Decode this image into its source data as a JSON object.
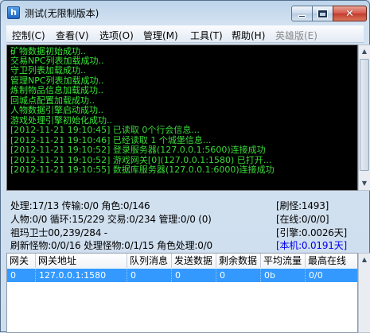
{
  "window": {
    "title": "测试(无限制版本)",
    "app_icon_letter": "h",
    "close_glyph": "✕"
  },
  "menu": [
    {
      "label": "控制(C)",
      "enabled": true
    },
    {
      "label": "查看(V)",
      "enabled": true
    },
    {
      "label": "选项(O)",
      "enabled": true
    },
    {
      "label": "管理(M)",
      "enabled": true
    },
    {
      "label": "工具(T)",
      "enabled": true
    },
    {
      "label": "帮助(H)",
      "enabled": true
    },
    {
      "label": "英雄版(E)",
      "enabled": false
    }
  ],
  "log": [
    "矿物数据初始成功..",
    "交易NPC列表加载成功..",
    "守卫列表加载成功..",
    "管理NPC列表加载成功..",
    "炼制物品信息加载成功..",
    "回城点配置加载成功..",
    "人物数据引擎启动成功..",
    "游戏处理引擎初始化成功..",
    "[2012-11-21 19:10:45] 已读取 0个行会信息...",
    "[2012-11-21 19:10:46] 已经读取 1 个城堡信息...",
    "[2012-11-21 19:10:52] 登录服务器(127.0.0.1:5600)连接成功",
    "[2012-11-21 19:10:52] 游戏网关[0](127.0.0.1:1580) 已打开...",
    "[2012-11-21 19:10:55] 数据库服务器(127.0.0.1:6000)连接成功"
  ],
  "stats": {
    "row1": "处理:17/13 传输:0/0 角色:0/146",
    "row2": "人物:0/0 循环:15/229 交易:0/234 管理:0/0 (0)",
    "row3": "祖玛卫士00,239/284 -",
    "row4": "刷新怪物:0/0/16 处理怪物:0/1/15 角色处理:0/0",
    "refresh_monsters": "[刷怪:1493]",
    "online": "[在线:0/0/0]",
    "engine": "[引擎:0.0026天]",
    "local": "[本机:0.0191天]"
  },
  "colors": {
    "log_text": "#37e837",
    "log_bg": "#000000",
    "selection": "#3399ff",
    "local_stat": "#0000ee"
  },
  "table": {
    "columns": [
      "网关",
      "网关地址",
      "队列消息",
      "发送数据",
      "剩余数据",
      "平均流量",
      "最高在线"
    ],
    "rows": [
      [
        "0",
        "127.0.0.1:1580",
        "0",
        "0",
        "0",
        "0b",
        "0/0"
      ]
    ]
  }
}
